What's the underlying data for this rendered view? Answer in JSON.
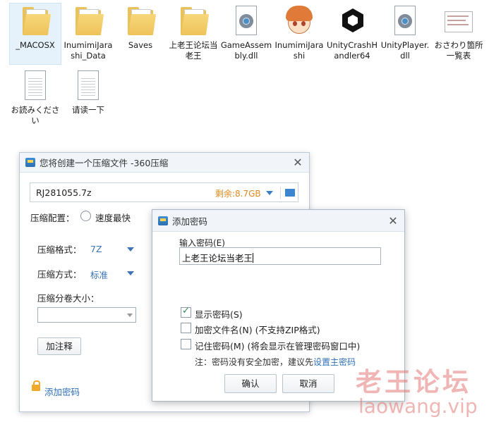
{
  "desktop": {
    "files": [
      {
        "label": "_MACOSX",
        "icon": "folder-icon",
        "selected": true
      },
      {
        "label": "InumimiJarashi_Data",
        "icon": "folder-icon",
        "selected": false
      },
      {
        "label": "Saves",
        "icon": "folder-icon",
        "selected": false
      },
      {
        "label": "上老王论坛当老王",
        "icon": "folder-icon",
        "selected": false
      },
      {
        "label": "GameAssembly.dll",
        "icon": "dll-gear-icon",
        "selected": false
      },
      {
        "label": "InumimiJarashi",
        "icon": "anime-avatar-icon",
        "selected": false
      },
      {
        "label": "UnityCrashHandler64",
        "icon": "unity-icon",
        "selected": false
      },
      {
        "label": "UnityPlayer.dll",
        "icon": "dll-gear-icon",
        "selected": false
      },
      {
        "label": "おさわり箇所一覧表",
        "icon": "spreadsheet-icon",
        "selected": false
      },
      {
        "label": "お読みください",
        "icon": "text-file-icon",
        "selected": false
      },
      {
        "label": "请读一下",
        "icon": "text-file-icon",
        "selected": false
      }
    ]
  },
  "main_window": {
    "title": "您将创建一个压缩文件 -360压缩",
    "archive_name": "RJ281055.7z",
    "free_space": "剩余:8.7GB",
    "compress_config_label": "压缩配置：",
    "speed_option": "速度最快",
    "format_label": "压缩格式：",
    "format_value": "7Z",
    "method_label": "压缩方式：",
    "method_value": "标准",
    "volume_label": "压缩分卷大小：",
    "volume_value": "",
    "comment_button": "加注释",
    "add_password_link": "添加密码"
  },
  "password_dialog": {
    "title": "添加密码",
    "input_label": "输入密码(E)",
    "password_value": "上老王论坛当老王",
    "show_password": {
      "label": "显示密码(S)",
      "checked": true
    },
    "encrypt_names": {
      "label": "加密文件名(N) (不支持ZIP格式)",
      "checked": false
    },
    "remember_password": {
      "label": "记住密码(M) (将会显示在管理密码窗口中)",
      "checked": false
    },
    "note_prefix": "注：密码没有安全加密，建议先",
    "note_link": "设置主密码",
    "ok_button": "确认",
    "cancel_button": "取消"
  },
  "watermark": {
    "title": "老王论坛",
    "url": "laowang.vip"
  },
  "colors": {
    "accent_blue": "#2f6fb8",
    "free_space_orange": "#e08a1c",
    "watermark_red": "#e47878"
  }
}
